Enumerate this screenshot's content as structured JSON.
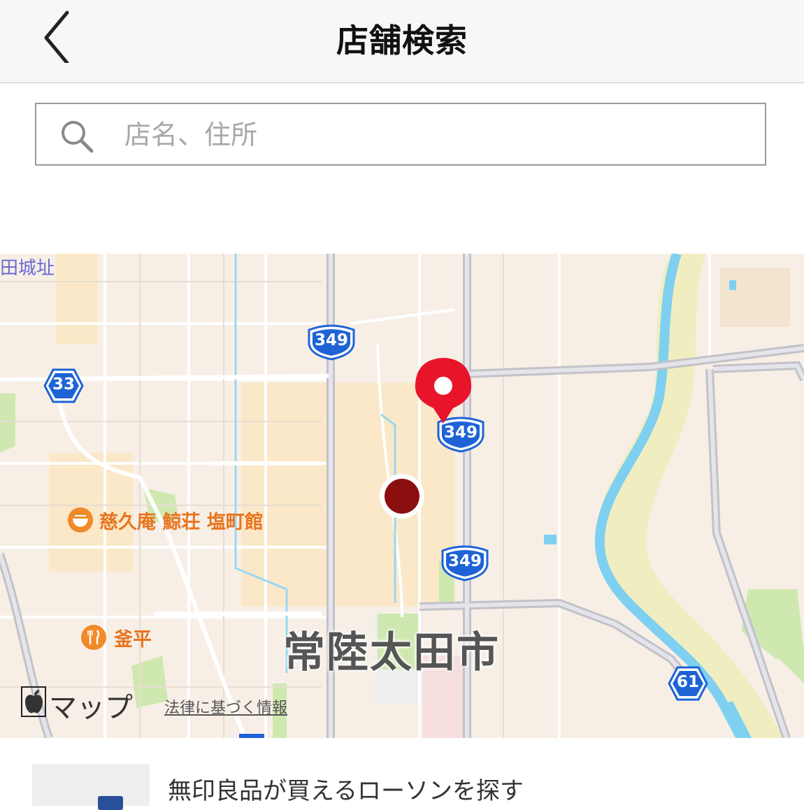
{
  "header": {
    "title": "店舗検索"
  },
  "search": {
    "placeholder": "店名、住所"
  },
  "map": {
    "place_top_left": "田城址",
    "city": "常陸太田市",
    "route_shields": [
      "349",
      "33",
      "349",
      "349",
      "61"
    ],
    "pois": [
      {
        "name": "慈久庵 鯨荘 塩町館",
        "icon": "ramen-icon"
      },
      {
        "name": "釜平",
        "icon": "fork-knife-icon"
      }
    ],
    "attribution": {
      "brand": "マップ",
      "legal": "法律に基づく情報"
    },
    "colors": {
      "land": "#f7efe6",
      "urban": "#fae8c8",
      "park": "#cfe8b0",
      "water": "#7fd0f0",
      "shield": "#1e63d6",
      "pin": "#e8142a",
      "location_dot": "#8b0f0f"
    }
  },
  "list": {
    "item_text": "無印良品が買えるローソンを探す"
  }
}
